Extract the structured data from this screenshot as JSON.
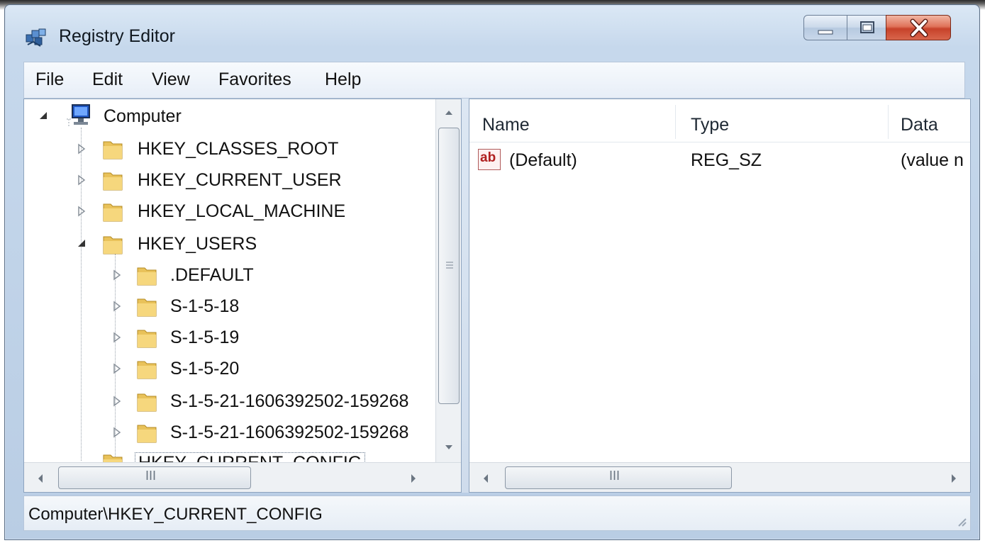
{
  "window": {
    "title": "Registry Editor"
  },
  "menu": [
    "File",
    "Edit",
    "View",
    "Favorites",
    "Help"
  ],
  "tree": {
    "root": "Computer",
    "hives": [
      "HKEY_CLASSES_ROOT",
      "HKEY_CURRENT_USER",
      "HKEY_LOCAL_MACHINE",
      "HKEY_USERS",
      "HKEY_CURRENT_CONFIG"
    ],
    "users_children": [
      ".DEFAULT",
      "S-1-5-18",
      "S-1-5-19",
      "S-1-5-20",
      "S-1-5-21-1606392502-159268",
      "S-1-5-21-1606392502-159268"
    ],
    "scroll_thumb_glyph": "III"
  },
  "list": {
    "columns": [
      "Name",
      "Type",
      "Data"
    ],
    "rows": [
      {
        "name": "(Default)",
        "type": "REG_SZ",
        "data": "(value n",
        "icon_label": "ab"
      }
    ],
    "scroll_thumb_glyph": "III"
  },
  "status": {
    "path": "Computer\\HKEY_CURRENT_CONFIG"
  },
  "icons": {
    "app": "registry-editor-icon",
    "computer": "computer-icon",
    "folder": "folder-icon",
    "value": "string-value-icon"
  },
  "colors": {
    "close_button": "#c7422a",
    "folder": "#e9c25a",
    "frame": "#c6d8ec"
  }
}
